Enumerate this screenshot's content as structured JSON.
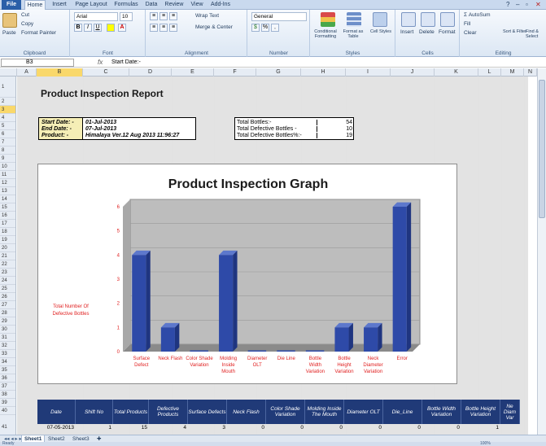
{
  "tabs": [
    "File",
    "Home",
    "Insert",
    "Page Layout",
    "Formulas",
    "Data",
    "Review",
    "View",
    "Add-Ins"
  ],
  "ribbon": {
    "clipboard": {
      "paste": "Paste",
      "cut": "Cut",
      "copy": "Copy",
      "format_painter": "Format Painter",
      "label": "Clipboard"
    },
    "font": {
      "name": "Arial",
      "size": "10",
      "label": "Font",
      "bold": "B",
      "italic": "I",
      "underline": "U"
    },
    "alignment": {
      "wrap": "Wrap Text",
      "merge": "Merge & Center",
      "label": "Alignment"
    },
    "number": {
      "format": "General",
      "label": "Number",
      "pct": "%"
    },
    "styles": {
      "cond": "Conditional Formatting",
      "table": "Format as Table",
      "cell": "Cell Styles",
      "label": "Styles"
    },
    "cells": {
      "insert": "Insert",
      "delete": "Delete",
      "format": "Format",
      "label": "Cells"
    },
    "editing": {
      "autosum": "AutoSum",
      "fill": "Fill",
      "clear": "Clear",
      "sort": "Sort & Filter",
      "find": "Find & Select",
      "label": "Editing"
    }
  },
  "formula_bar": {
    "name_box": "B3",
    "fx": "fx",
    "formula": "Start Date:-"
  },
  "columns": [
    "A",
    "B",
    "C",
    "D",
    "E",
    "F",
    "G",
    "H",
    "I",
    "J",
    "K",
    "L",
    "M",
    "N"
  ],
  "rows": [
    "1",
    "2",
    "3",
    "4",
    "5",
    "6",
    "7",
    "8",
    "9",
    "10",
    "11",
    "12",
    "13",
    "14",
    "15",
    "16",
    "17",
    "18",
    "19",
    "20",
    "21",
    "22",
    "23",
    "24",
    "25",
    "26",
    "27",
    "28",
    "29",
    "30",
    "31",
    "32",
    "33",
    "34",
    "35",
    "36",
    "37",
    "38",
    "39",
    "40",
    "41",
    "42"
  ],
  "report": {
    "title": "Product Inspection Report",
    "start_label": "Start Date:  -",
    "start_value": "01-Jul-2013",
    "end_label": "End Date:  -",
    "end_value": "07-Jul-2013",
    "product_label": "Product:  -",
    "product_value": "Himalaya Ver.12 Aug 2013 11:96:27",
    "total_bottles_label": "Total Bottles:-",
    "total_bottles": "54",
    "defective_label": "Total Defective Bottles -",
    "defective": "10",
    "defective_pct_label": "Total Defective Bottles%:-",
    "defective_pct": "19"
  },
  "chart_data": {
    "type": "bar",
    "title": "Product Inspection Graph",
    "ylabel": "Total Number Of Defective Bottles",
    "ylim": [
      0,
      6
    ],
    "yticks": [
      "0",
      "1",
      "2",
      "3",
      "4",
      "5",
      "6"
    ],
    "categories": [
      "Surface Defect",
      "Neck Flash",
      "Color Shade Variation",
      "Molding Inside Mouth",
      "Diameter OLT",
      "Die Line",
      "Bottle Width Variation",
      "Bottle Height Variation",
      "Neck Diameter Variation",
      "Error"
    ],
    "values": [
      4,
      1,
      0,
      4,
      0,
      0,
      0,
      1,
      1,
      6
    ],
    "bar_color": "#2e4aa8",
    "plot_color": "#bdbdbd"
  },
  "table": {
    "headers": [
      "Date",
      "Shift No",
      "Total Products",
      "Defective Products",
      "Surface Defects",
      "Neck Flash",
      "Color Shade Variation",
      "Molding Inside The Mouth",
      "Diameter OLT",
      "Die_Line",
      "Bottle Width Variation",
      "Bottle Height Variation",
      "Ne Diam Var"
    ],
    "row1": [
      "07-05-2013",
      "1",
      "15",
      "4",
      "3",
      "0",
      "0",
      "0",
      "0",
      "0",
      "0",
      "1"
    ]
  },
  "sheets": [
    "Sheet1",
    "Sheet2",
    "Sheet3"
  ],
  "status": {
    "ready": "Ready",
    "zoom": "100%"
  }
}
